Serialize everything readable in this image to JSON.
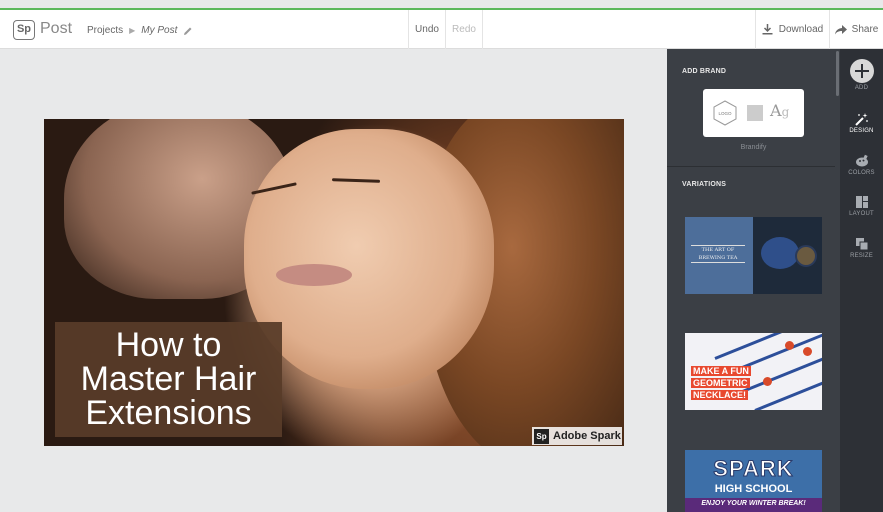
{
  "topbar": {
    "logo_mark": "Sp",
    "app_name": "Post",
    "breadcrumb_projects": "Projects",
    "breadcrumb_current": "My Post",
    "undo_label": "Undo",
    "redo_label": "Redo",
    "download_label": "Download",
    "share_label": "Share"
  },
  "canvas": {
    "title_lines": [
      "How to",
      "Master Hair",
      "Extensions"
    ],
    "watermark_mark": "Sp",
    "watermark_text": "Adobe Spark"
  },
  "panel": {
    "add_brand_label": "ADD BRAND",
    "brand_logo_text": "LOGO",
    "brand_type_sample": "A",
    "brand_type_sample_2": "g",
    "brandify_label": "Brandify",
    "variations_label": "VARIATIONS",
    "variations": [
      {
        "text": "THE ART OF BREWING TEA"
      },
      {
        "lines": [
          "MAKE A FUN",
          "GEOMETRIC",
          "NECKLACE!"
        ]
      },
      {
        "title": "SPARK",
        "subtitle": "HIGH SCHOOL",
        "tagline": "ENJOY YOUR WINTER BREAK!"
      }
    ]
  },
  "rail": {
    "items": [
      {
        "label": "ADD",
        "icon": "plus-icon"
      },
      {
        "label": "DESIGN",
        "icon": "magic-wand-icon",
        "active": true
      },
      {
        "label": "COLORS",
        "icon": "palette-icon"
      },
      {
        "label": "LAYOUT",
        "icon": "layout-icon"
      },
      {
        "label": "RESIZE",
        "icon": "resize-icon"
      }
    ]
  },
  "colors": {
    "accent_green": "#5cb85c",
    "panel_bg": "#3b3f45",
    "rail_bg": "#2d3036",
    "title_box": "#583c28"
  }
}
